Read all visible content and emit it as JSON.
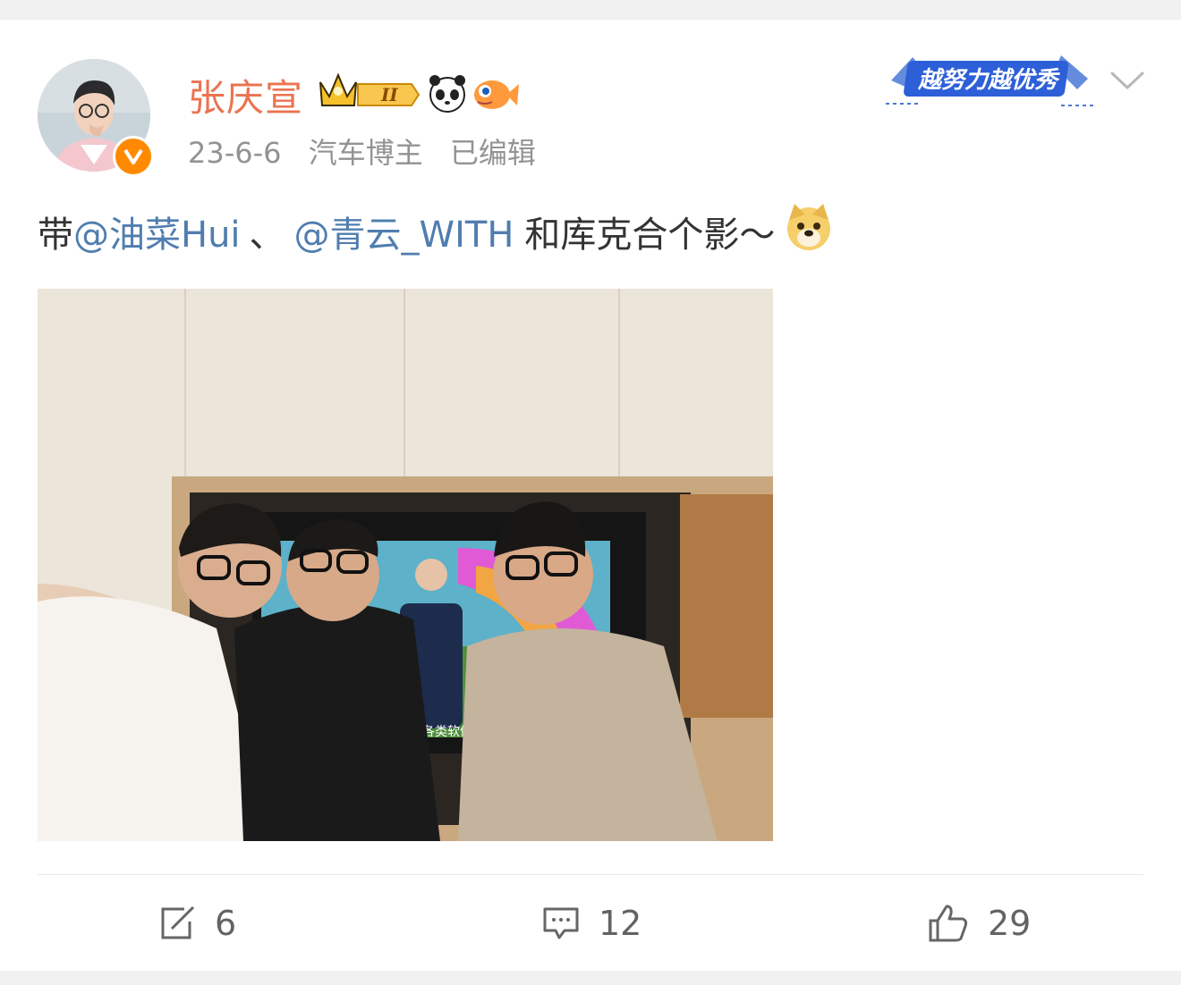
{
  "post": {
    "author_name": "张庆宣",
    "date": "23-6-6",
    "author_tag": "汽车博主",
    "edited_label": "已编辑",
    "badge_level": "II",
    "promo_text": "越努力越优秀",
    "content": {
      "prefix": "带",
      "mention1": "@油菜Hui",
      "separator": "、",
      "mention2": "@青云_WITH",
      "suffix": "和库克合个影～"
    },
    "photo_tv_caption": "各类软件"
  },
  "actions": {
    "repost_count": "6",
    "comment_count": "12",
    "like_count": "29"
  },
  "colors": {
    "name": "#eb7350",
    "mention": "#507daf",
    "meta": "#939393",
    "verified": "#ff8a00"
  }
}
